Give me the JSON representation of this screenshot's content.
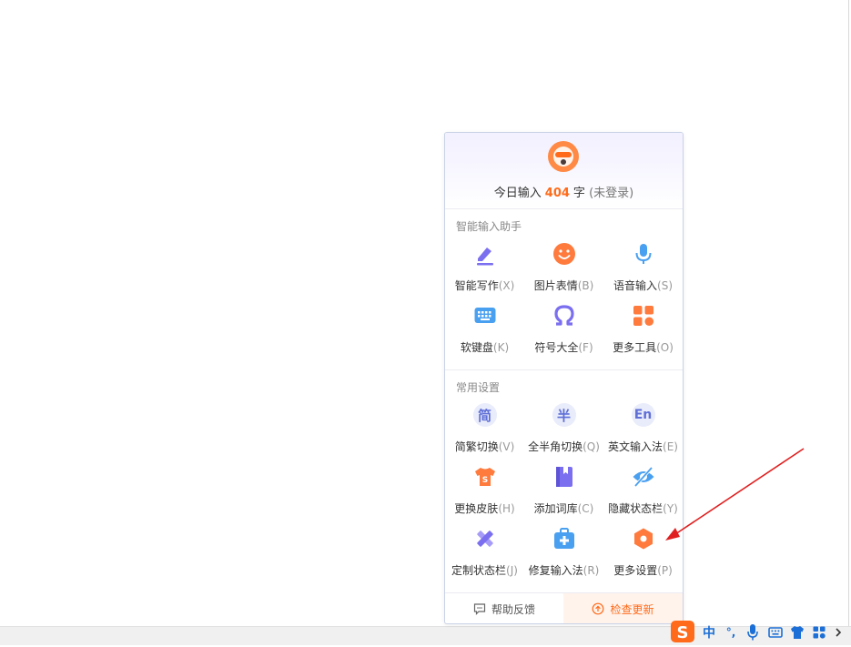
{
  "header": {
    "prefix": "今日输入",
    "count": "404",
    "unit": "字",
    "status": "(未登录)"
  },
  "sections": [
    {
      "title": "智能输入助手",
      "items": [
        {
          "label": "智能写作",
          "key": "(X)",
          "icon": "pen-write-icon"
        },
        {
          "label": "图片表情",
          "key": "(B)",
          "icon": "smiley-icon"
        },
        {
          "label": "语音输入",
          "key": "(S)",
          "icon": "microphone-icon"
        },
        {
          "label": "软键盘",
          "key": "(K)",
          "icon": "keyboard-icon"
        },
        {
          "label": "符号大全",
          "key": "(F)",
          "icon": "omega-icon"
        },
        {
          "label": "更多工具",
          "key": "(O)",
          "icon": "grid-tools-icon"
        }
      ]
    },
    {
      "title": "常用设置",
      "items": [
        {
          "label": "简繁切换",
          "key": "(V)",
          "icon": "jian-char-icon",
          "glyph": "简"
        },
        {
          "label": "全半角切换",
          "key": "(Q)",
          "icon": "ban-char-icon",
          "glyph": "半"
        },
        {
          "label": "英文输入法",
          "key": "(E)",
          "icon": "en-char-icon",
          "glyph": "En"
        },
        {
          "label": "更换皮肤",
          "key": "(H)",
          "icon": "tshirt-icon"
        },
        {
          "label": "添加词库",
          "key": "(C)",
          "icon": "book-icon"
        },
        {
          "label": "隐藏状态栏",
          "key": "(Y)",
          "icon": "eye-hidden-icon"
        },
        {
          "label": "定制状态栏",
          "key": "(J)",
          "icon": "ruler-pencil-icon"
        },
        {
          "label": "修复输入法",
          "key": "(R)",
          "icon": "medkit-icon"
        },
        {
          "label": "更多设置",
          "key": "(P)",
          "icon": "hex-gear-icon"
        }
      ]
    }
  ],
  "footer": {
    "help": "帮助反馈",
    "update": "检查更新"
  },
  "statusbar": {
    "lang": "中",
    "punct": "°,"
  },
  "colors": {
    "accent": "#ff6b1a",
    "purple": "#7b6ff0",
    "blue": "#4aa0f0",
    "arrow": "#e02020"
  }
}
